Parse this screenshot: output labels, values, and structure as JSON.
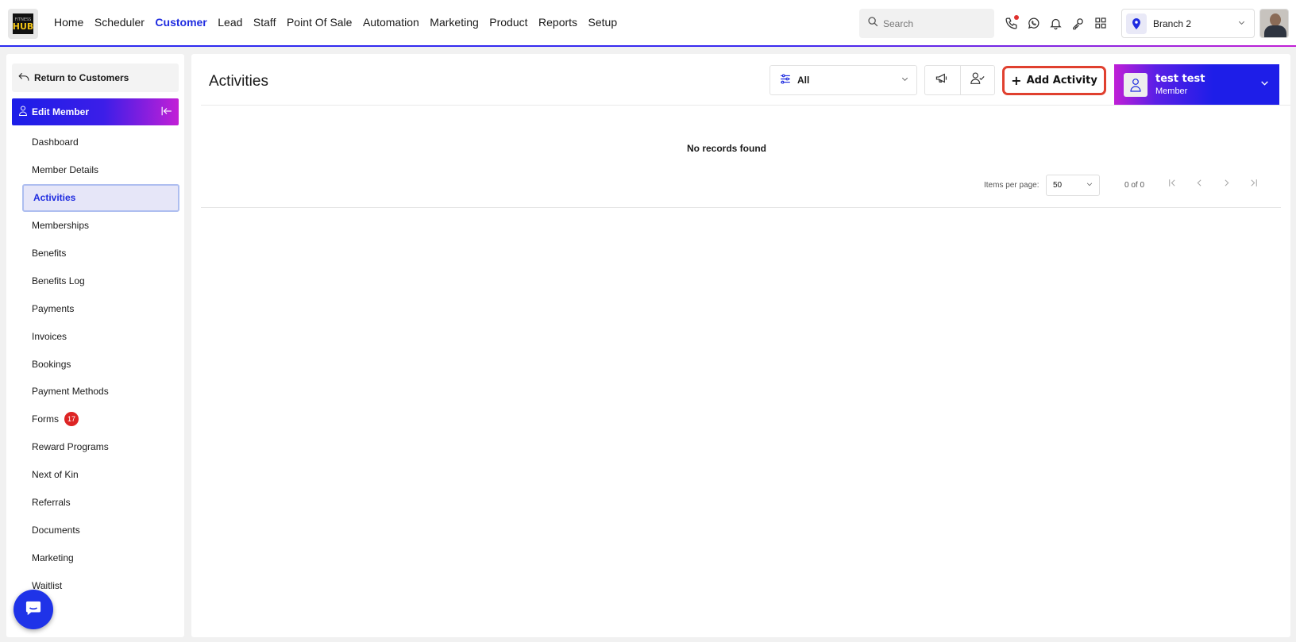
{
  "logo": {
    "line1": "FITNESS",
    "line2": "HUB"
  },
  "nav": [
    "Home",
    "Scheduler",
    "Customer",
    "Lead",
    "Staff",
    "Point Of Sale",
    "Automation",
    "Marketing",
    "Product",
    "Reports",
    "Setup"
  ],
  "nav_active": "Customer",
  "search": {
    "placeholder": "Search"
  },
  "top_icons": [
    "phone-icon",
    "whatsapp-icon",
    "bell-icon",
    "key-icon",
    "apps-grid-icon"
  ],
  "branch": {
    "label": "Branch 2"
  },
  "sidebar": {
    "return_label": "Return to Customers",
    "edit_label": "Edit Member",
    "items": [
      {
        "label": "Dashboard"
      },
      {
        "label": "Member Details"
      },
      {
        "label": "Activities",
        "active": true
      },
      {
        "label": "Memberships"
      },
      {
        "label": "Benefits"
      },
      {
        "label": "Benefits Log"
      },
      {
        "label": "Payments"
      },
      {
        "label": "Invoices"
      },
      {
        "label": "Bookings"
      },
      {
        "label": "Payment Methods"
      },
      {
        "label": "Forms",
        "badge": "17"
      },
      {
        "label": "Reward Programs"
      },
      {
        "label": "Next of Kin"
      },
      {
        "label": "Referrals"
      },
      {
        "label": "Documents"
      },
      {
        "label": "Marketing"
      },
      {
        "label": "Waitlist"
      }
    ]
  },
  "main": {
    "title": "Activities",
    "filter_value": "All",
    "add_button": "Add Activity",
    "member": {
      "name": "test test",
      "role": "Member"
    },
    "empty_text": "No records found",
    "pagination": {
      "items_per_page_label": "Items per page:",
      "items_per_page": "50",
      "range": "0 of 0"
    }
  },
  "colors": {
    "accent": "#1f2ce0",
    "gradient_end": "#c21fd6",
    "highlight_border": "#e0402f",
    "badge": "#dd2424"
  }
}
